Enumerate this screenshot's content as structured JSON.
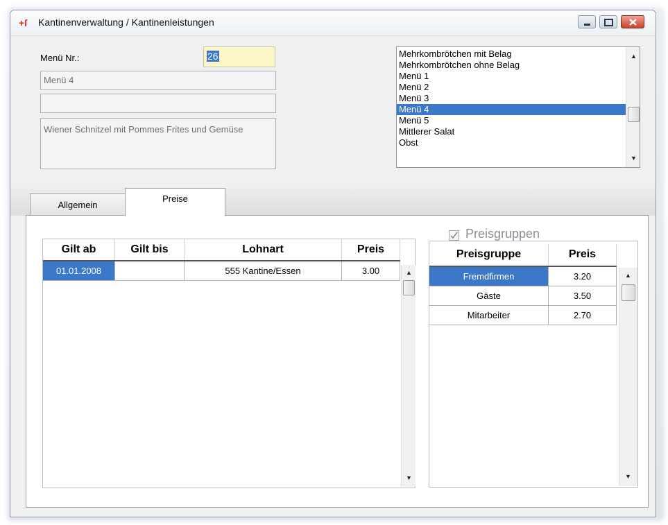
{
  "window": {
    "title": "Kantinenverwaltung / Kantinenleistungen",
    "app_icon": "app-logo-icon",
    "buttons": [
      "minimize-icon",
      "maximize-icon",
      "close-icon"
    ]
  },
  "form": {
    "menu_nr_label": "Menü Nr.:",
    "menu_nr_value": "26",
    "name_value": "Menü 4",
    "second_value": "",
    "description_value": "Wiener Schnitzel mit Pommes Frites und Gemüse"
  },
  "menu_list": {
    "items": [
      "Mehrkombrötchen mit Belag",
      "Mehrkombrötchen ohne Belag",
      "Menü 1",
      "Menü 2",
      "Menü 3",
      "Menü 4",
      "Menü 5",
      "Mittlerer Salat",
      "Obst"
    ],
    "selected_index": 5
  },
  "tabs": [
    {
      "label": "Allgemein",
      "active": false
    },
    {
      "label": "Preise",
      "active": true
    }
  ],
  "prices_table": {
    "headers": [
      "Gilt ab",
      "Gilt bis",
      "Lohnart",
      "Preis"
    ],
    "rows": [
      {
        "gilt_ab": "01.01.2008",
        "gilt_bis": "",
        "lohnart": "555 Kantine/Essen",
        "preis": "3.00"
      }
    ]
  },
  "price_groups": {
    "title": "Preisgruppen",
    "checked": true,
    "headers": [
      "Preisgruppe",
      "Preis"
    ],
    "rows": [
      {
        "gruppe": "Fremdfirmen",
        "preis": "3.20"
      },
      {
        "gruppe": "Gäste",
        "preis": "3.50"
      },
      {
        "gruppe": "Mitarbeiter",
        "preis": "2.70"
      }
    ],
    "selected_index": 0
  },
  "colors": {
    "selection": "#3c78c8",
    "menu_nr_bg": "#fcf6c8",
    "close_button": "#c9432a"
  }
}
